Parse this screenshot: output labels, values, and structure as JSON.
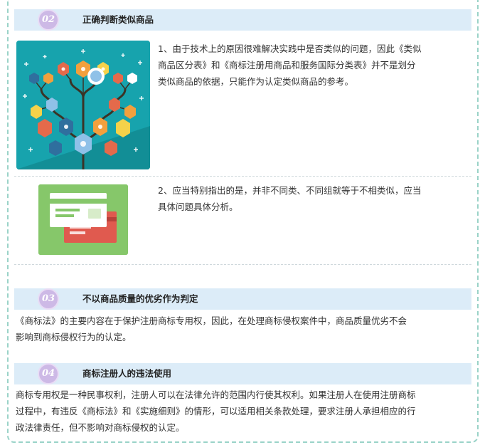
{
  "sections": [
    {
      "num": "02",
      "title": "正确判断类似商品"
    },
    {
      "num": "03",
      "title": "不以商品质量的优劣作为判定"
    },
    {
      "num": "04",
      "title": "商标注册人的违法使用"
    }
  ],
  "section2": {
    "item1_lines": [
      "1、由于技术上的原因很难解决实践中是否类似的问题，因此《类似",
      "商品区分表》和《商标注册用商品和服务国际分类表》并不是划分",
      "类似商品的依据，只能作为认定类似商品的参考。"
    ],
    "item2_lines": [
      "2、应当特别指出的是，并非不同类、不同组就等于不相类似，应当",
      "具体问题具体分析。"
    ]
  },
  "section3": {
    "lines": [
      "《商标法》的主要内容在于保护注册商标专用权，因此，在处理商标侵权案件中，商品质量优劣不会",
      "影响到商标侵权行为的认定。"
    ]
  },
  "section4": {
    "lines": [
      "商标专用权是一种民事权利，注册人可以在法律允许的范围内行使其权利。如果注册人在使用注册商标",
      "过程中，有违反《商标法》和《实施细则》的情形，可以适用相关条款处理，要求注册人承担相应的行",
      "政法律责任，但不影响对商标侵权的认定。"
    ]
  },
  "colors": {
    "header_bg": "#dcecf8",
    "badge": "#cdb9e6",
    "frame_border": "#9ad3c8",
    "tree_bg": "#1aa0a8",
    "cards_bg": "#86c76a",
    "card_red": "#e05a4f"
  }
}
